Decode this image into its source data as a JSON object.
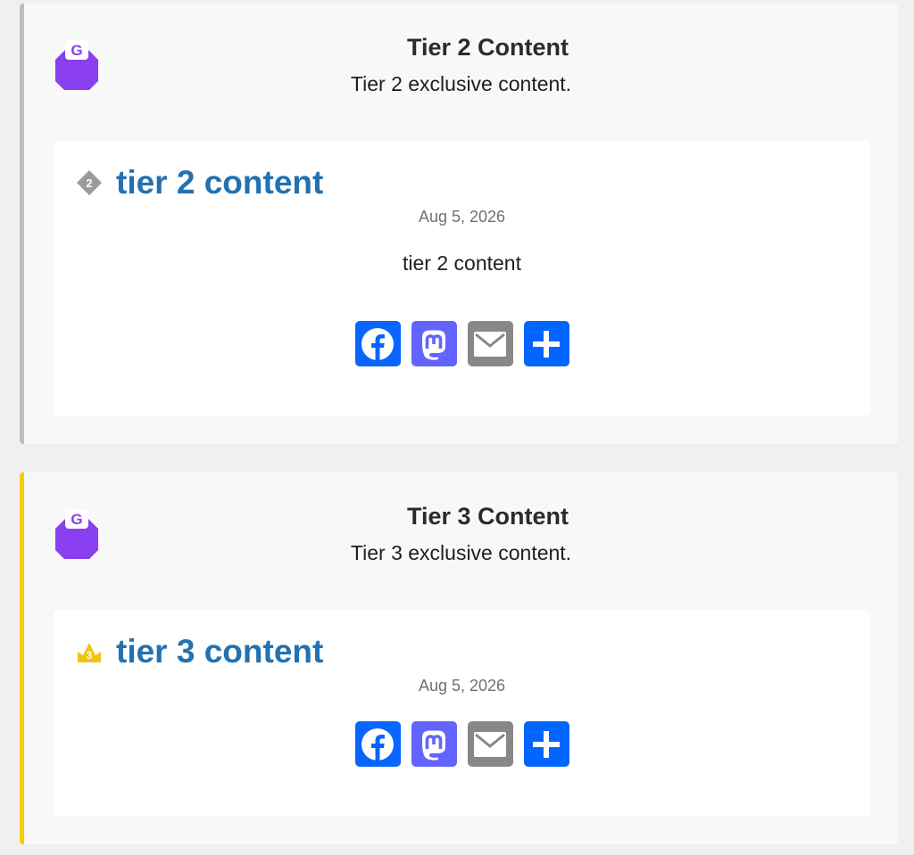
{
  "sections": [
    {
      "title": "Tier 2 Content",
      "description": "Tier 2 exclusive content.",
      "accent_color": "#bdbdbd",
      "post": {
        "tier_icon": "tier-2-diamond-icon",
        "title": "tier 2 content",
        "date": "Aug 5, 2026",
        "body": "tier 2 content"
      }
    },
    {
      "title": "Tier 3 Content",
      "description": "Tier 3 exclusive content.",
      "accent_color": "#f5cd00",
      "post": {
        "tier_icon": "tier-3-crown-icon",
        "title": "tier 3 content",
        "date": "Aug 5, 2026"
      }
    }
  ],
  "logo": {
    "letter": "G",
    "color": "#8a3ff0"
  },
  "tier_badges": {
    "tier2": "2",
    "tier3": "3"
  },
  "share_buttons": [
    {
      "name": "facebook",
      "icon": "facebook-icon",
      "color": "#0866ff"
    },
    {
      "name": "mastodon",
      "icon": "mastodon-icon",
      "color": "#6364ff"
    },
    {
      "name": "email",
      "icon": "email-icon",
      "color": "#888888"
    },
    {
      "name": "share",
      "icon": "plus-icon",
      "color": "#0166ff"
    }
  ],
  "colors": {
    "link": "#2271b1",
    "date": "#707070"
  }
}
